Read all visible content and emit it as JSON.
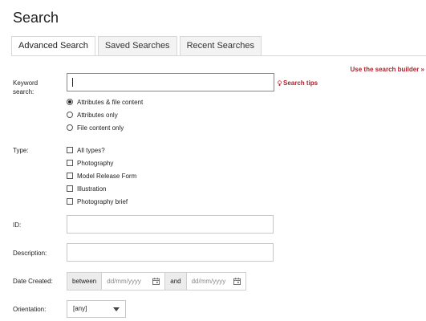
{
  "page": {
    "title": "Search"
  },
  "tabs": [
    {
      "label": "Advanced Search",
      "active": true
    },
    {
      "label": "Saved Searches",
      "active": false
    },
    {
      "label": "Recent Searches",
      "active": false
    }
  ],
  "builder_link": "Use the search builder »",
  "keyword": {
    "label": "Keyword search:",
    "value": "",
    "tips_label": "Search tips",
    "options": [
      {
        "label": "Attributes & file content",
        "checked": true
      },
      {
        "label": "Attributes only",
        "checked": false
      },
      {
        "label": "File content only",
        "checked": false
      }
    ]
  },
  "type": {
    "label": "Type:",
    "options": [
      {
        "label": "All types?"
      },
      {
        "label": "Photography"
      },
      {
        "label": "Model Release Form"
      },
      {
        "label": "Illustration"
      },
      {
        "label": "Photography brief"
      }
    ]
  },
  "id_field": {
    "label": "ID:",
    "value": ""
  },
  "description": {
    "label": "Description:",
    "value": ""
  },
  "date_created": {
    "label": "Date Created:",
    "between_label": "between",
    "and_label": "and",
    "from_placeholder": "dd/mm/yyyy",
    "to_placeholder": "dd/mm/yyyy"
  },
  "orientation": {
    "label": "Orientation:",
    "value": "[any]"
  },
  "colors": {
    "accent": "#b0202a",
    "border": "#c8c8c8",
    "tab_bg": "#f3f3f3"
  }
}
